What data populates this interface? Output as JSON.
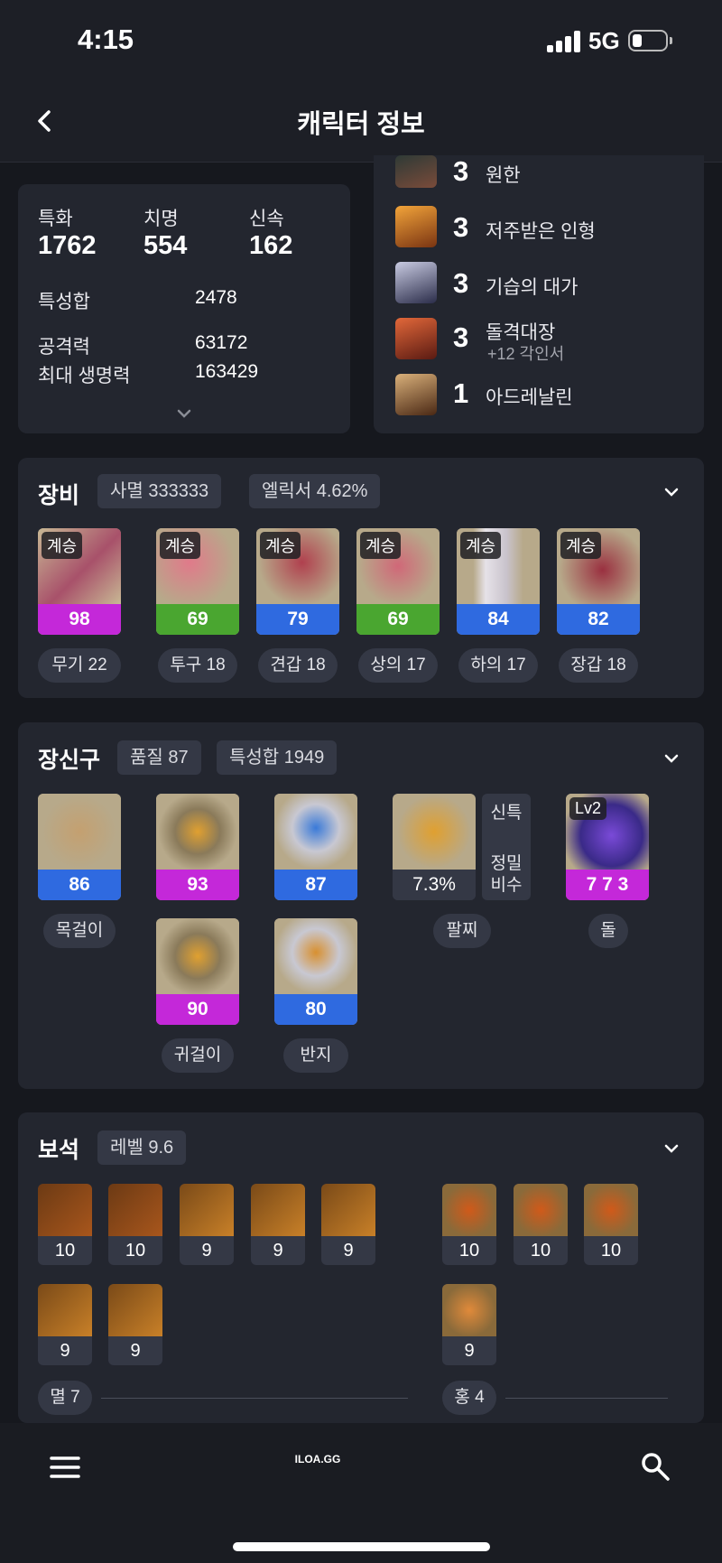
{
  "status_bar": {
    "time": "4:15",
    "network": "5G"
  },
  "header": {
    "title": "캐릭터 정보"
  },
  "stats": {
    "primary": [
      {
        "label": "특화",
        "value": "1762"
      },
      {
        "label": "치명",
        "value": "554"
      },
      {
        "label": "신속",
        "value": "162"
      }
    ],
    "rows": [
      {
        "label": "특성합",
        "value": "2478"
      },
      {
        "label": "공격력",
        "value": "63172"
      },
      {
        "label": "최대 생명력",
        "value": "163429"
      }
    ]
  },
  "engravings": [
    {
      "level": "3",
      "name": "원한",
      "sub": ""
    },
    {
      "level": "3",
      "name": "저주받은 인형",
      "sub": ""
    },
    {
      "level": "3",
      "name": "기습의 대가",
      "sub": ""
    },
    {
      "level": "3",
      "name": "돌격대장",
      "sub": "+12 각인서"
    },
    {
      "level": "1",
      "name": "아드레날린",
      "sub": ""
    }
  ],
  "equipment": {
    "title": "장비",
    "pills": [
      "사멸 333333",
      "엘릭서 4.62%"
    ],
    "items": [
      {
        "tag": "계승",
        "quality": "98",
        "slot": "무기 22",
        "color": "#c428d9"
      },
      {
        "tag": "계승",
        "quality": "69",
        "slot": "투구 18",
        "color": "#4aa630"
      },
      {
        "tag": "계승",
        "quality": "79",
        "slot": "견갑 18",
        "color": "#2f6ae0"
      },
      {
        "tag": "계승",
        "quality": "69",
        "slot": "상의 17",
        "color": "#4aa630"
      },
      {
        "tag": "계승",
        "quality": "84",
        "slot": "하의 17",
        "color": "#2f6ae0"
      },
      {
        "tag": "계승",
        "quality": "82",
        "slot": "장갑 18",
        "color": "#2f6ae0"
      }
    ]
  },
  "accessories": {
    "title": "장신구",
    "pills": [
      "품질 87",
      "특성합 1949"
    ],
    "necklace": {
      "quality": "86",
      "label": "목걸이",
      "color": "#2f6ae0"
    },
    "earrings": [
      {
        "quality": "93",
        "color": "#c428d9"
      },
      {
        "quality": "90",
        "color": "#c428d9"
      }
    ],
    "earring_label": "귀걸이",
    "rings": [
      {
        "quality": "87",
        "color": "#2f6ae0"
      },
      {
        "quality": "80",
        "color": "#2f6ae0"
      }
    ],
    "ring_label": "반지",
    "bracelet": {
      "value": "7.3%",
      "label": "팔찌",
      "effects_top": "신특",
      "effects_bottom_1": "정밀",
      "effects_bottom_2": "비수"
    },
    "stone": {
      "tag": "Lv2",
      "value": "7 7 3",
      "label": "돌",
      "color": "#c428d9"
    }
  },
  "gems": {
    "title": "보석",
    "pills": [
      "레벨 9.6"
    ],
    "left_row1": [
      "10",
      "10",
      "9",
      "9",
      "9"
    ],
    "left_row2": [
      "9",
      "9"
    ],
    "left_label": "멸 7",
    "right_row1": [
      "10",
      "10",
      "10"
    ],
    "right_row2": [
      "9"
    ],
    "right_label": "홍 4"
  },
  "bottom_nav": {
    "logo": "ILOA.GG"
  },
  "icons": [
    "chevron-left-icon",
    "chevron-down-icon",
    "menu-icon",
    "search-icon"
  ]
}
